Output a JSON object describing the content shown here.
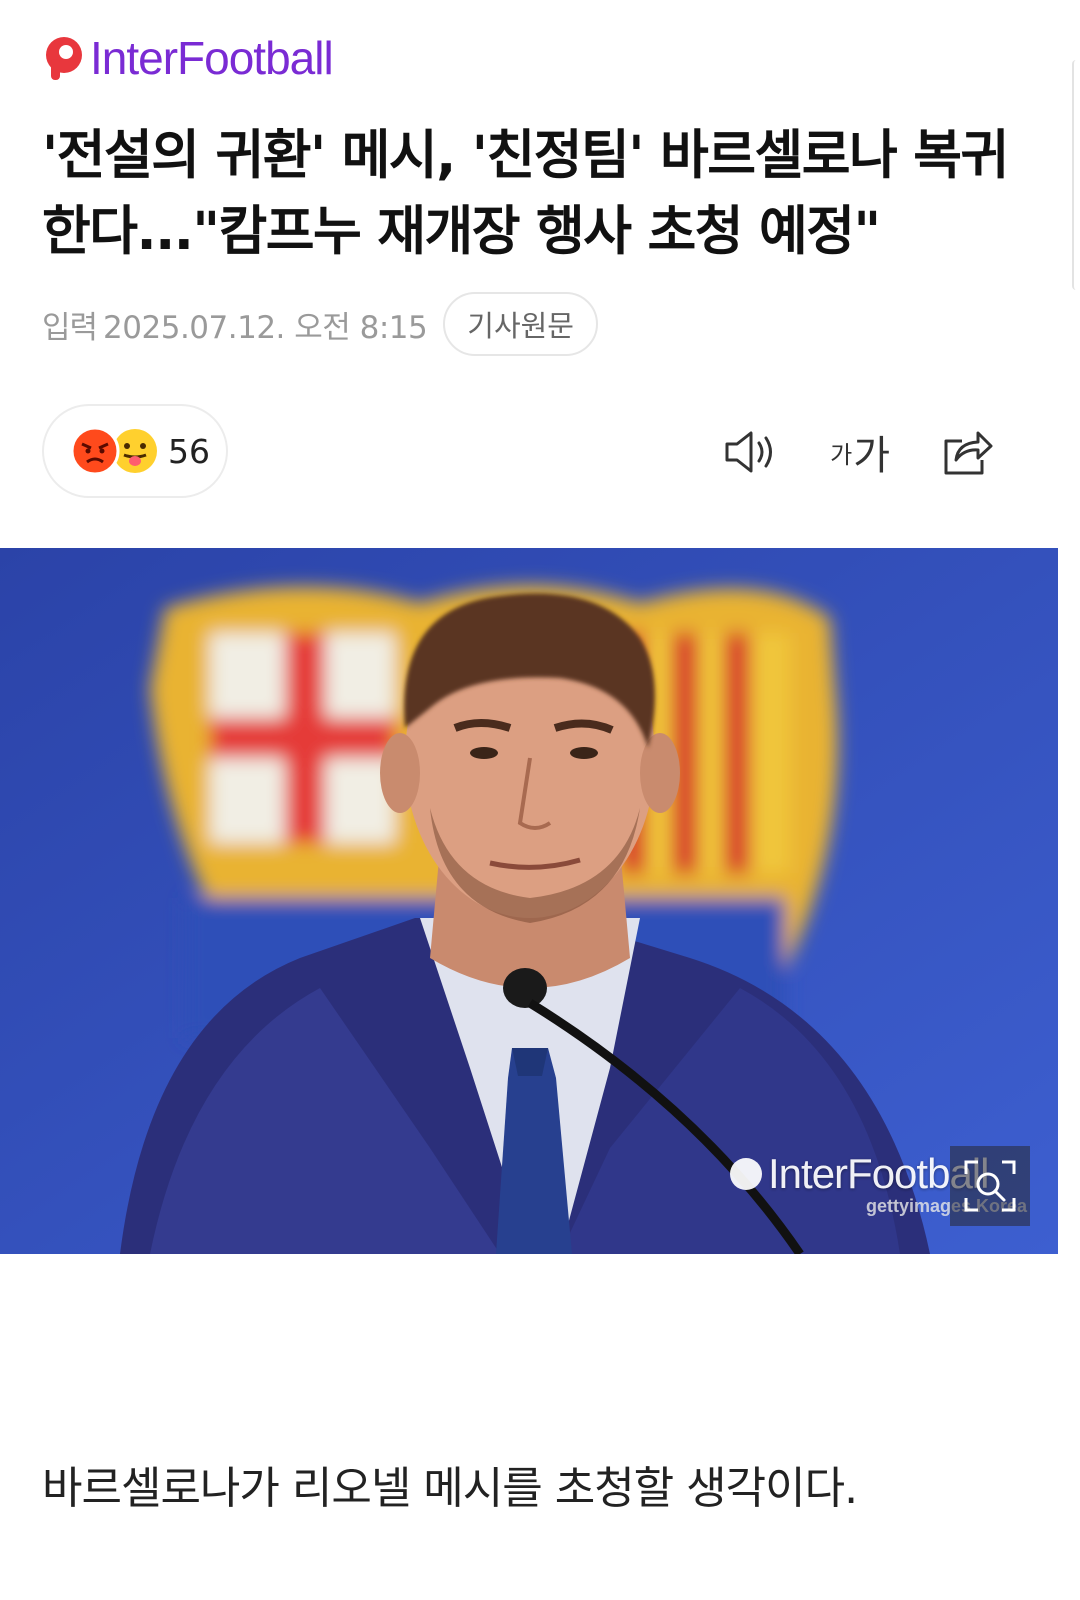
{
  "brand": {
    "logo_text": "InterFootball",
    "accent_color": "#e8373d",
    "text_color": "#7a2bd4"
  },
  "article": {
    "headline": "'전설의 귀환' 메시, '친정팀' 바르셀로나 복귀한다...\"캄프누 재개장 행사 초청 예정\"",
    "input_label": "입력",
    "timestamp": "2025.07.12. 오전 8:15",
    "origin_button": "기사원문",
    "first_paragraph": "바르셀로나가 리오넬 메시를 초청할 생각이다."
  },
  "reactions": {
    "icons": [
      "angry-face-icon",
      "tongue-face-icon"
    ],
    "count": "56"
  },
  "toolbar": {
    "icons": [
      "speaker-icon",
      "font-size-icon",
      "share-icon"
    ],
    "font_small": "가",
    "font_big": "가"
  },
  "photo": {
    "watermark": "InterFootball",
    "credit": "gettyimages Korea",
    "zoom_icon": "zoom-icon"
  }
}
